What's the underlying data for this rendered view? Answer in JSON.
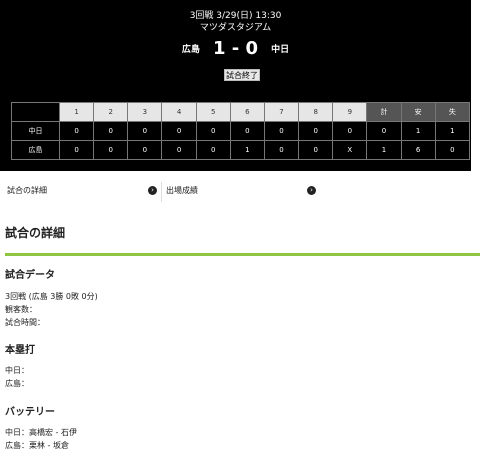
{
  "header": {
    "date_line": "3回戦 3/29(日) 13:30",
    "stadium": "マツダスタジアム",
    "home_team": "広島",
    "score": "1 - 0",
    "away_team": "中日",
    "status": "試合終了"
  },
  "linescore": {
    "headers": [
      "1",
      "2",
      "3",
      "4",
      "5",
      "6",
      "7",
      "8",
      "9",
      "計",
      "安",
      "失"
    ],
    "rows": [
      {
        "team": "中日",
        "values": [
          "0",
          "0",
          "0",
          "0",
          "0",
          "0",
          "0",
          "0",
          "0",
          "0",
          "1",
          "1"
        ]
      },
      {
        "team": "広島",
        "values": [
          "0",
          "0",
          "0",
          "0",
          "0",
          "1",
          "0",
          "0",
          "X",
          "1",
          "6",
          "0"
        ]
      }
    ]
  },
  "links": {
    "details": "試合の詳細",
    "stats": "出場成績"
  },
  "details": {
    "title": "試合の詳細",
    "data_heading": "試合データ",
    "record": "3回戦 (広島 3勝 0敗 0分)",
    "attendance": "観客数：",
    "duration": "試合時間：",
    "hr_heading": "本塁打",
    "hr_chunichi": "中日：",
    "hr_hiroshima": "広島：",
    "battery_heading": "バッテリー",
    "battery_chunichi": "中日：高橋宏 - 石伊",
    "battery_hiroshima": "広島：栗林 - 坂倉"
  }
}
